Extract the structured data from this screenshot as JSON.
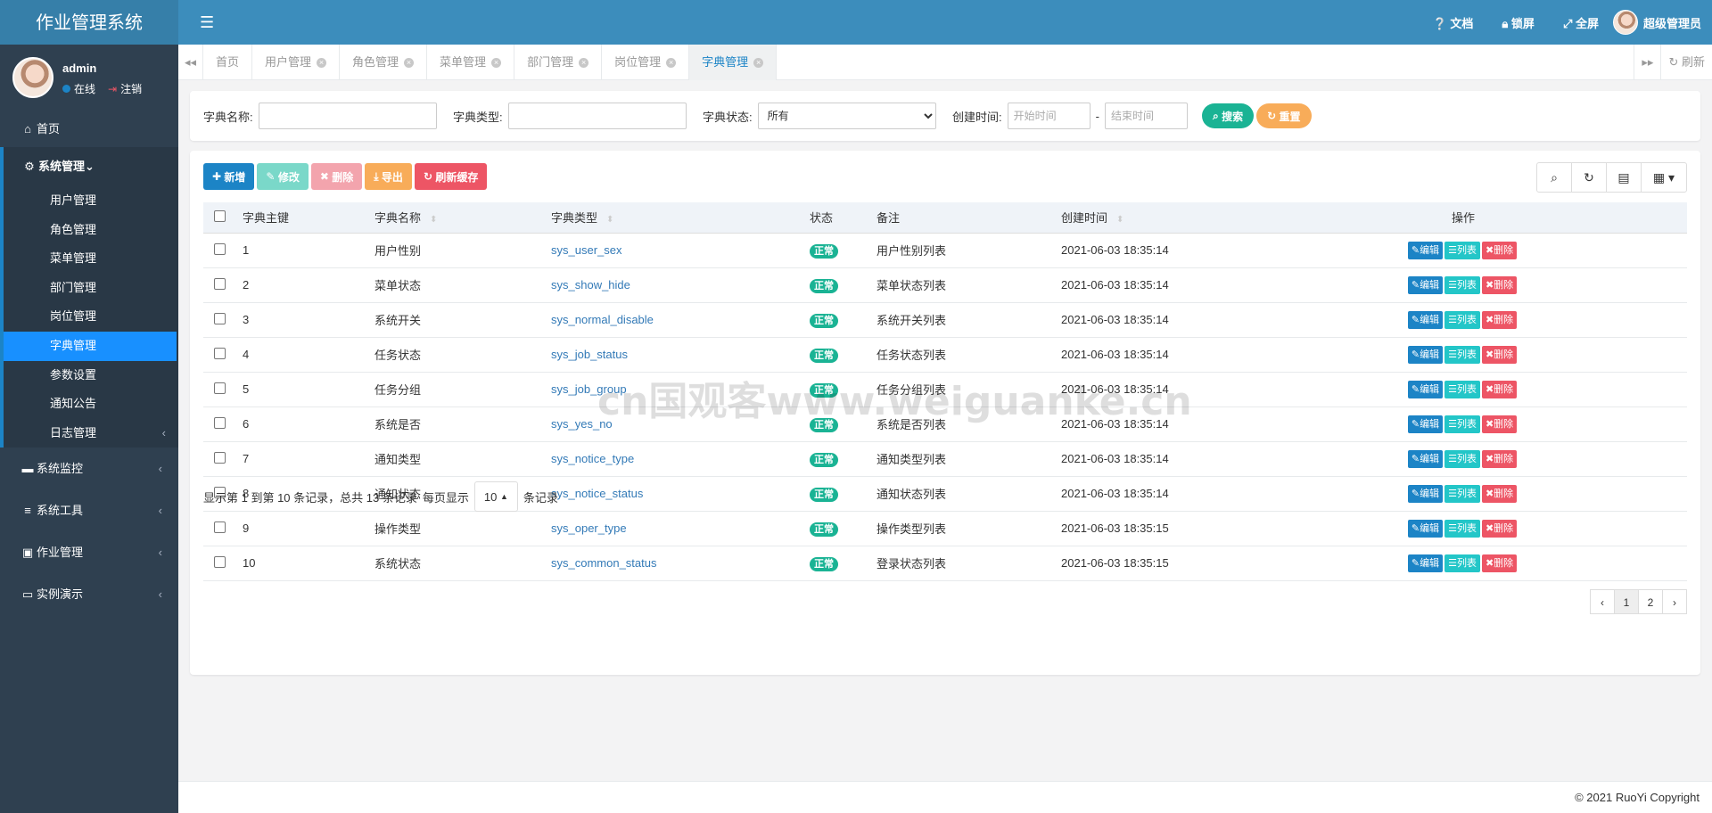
{
  "app": {
    "title": "作业管理系统"
  },
  "user": {
    "name": "admin",
    "status": "在线",
    "logout": "注销"
  },
  "topbar": {
    "doc": "文档",
    "lock": "锁屏",
    "fullscreen": "全屏",
    "username": "超级管理员"
  },
  "sidebar": {
    "home": "首页",
    "system": "系统管理",
    "system_items": [
      "用户管理",
      "角色管理",
      "菜单管理",
      "部门管理",
      "岗位管理",
      "字典管理",
      "参数设置",
      "通知公告",
      "日志管理"
    ],
    "monitor": "系统监控",
    "tools": "系统工具",
    "homework": "作业管理",
    "demo": "实例演示"
  },
  "tabs": {
    "home": "首页",
    "items": [
      "用户管理",
      "角色管理",
      "菜单管理",
      "部门管理",
      "岗位管理",
      "字典管理"
    ],
    "active": "字典管理",
    "refresh": "刷新"
  },
  "search": {
    "dict_name_label": "字典名称:",
    "dict_type_label": "字典类型:",
    "dict_status_label": "字典状态:",
    "dict_status_value": "所有",
    "create_time_label": "创建时间:",
    "start_placeholder": "开始时间",
    "end_placeholder": "结束时间",
    "separator": "-",
    "search_btn": "搜索",
    "reset_btn": "重置"
  },
  "toolbar": {
    "add": "新增",
    "edit": "修改",
    "delete": "删除",
    "export": "导出",
    "refresh_cache": "刷新缓存"
  },
  "colors": {
    "primary": "#1c84c6",
    "success": "#1ab394",
    "info": "#23c6c8",
    "danger": "#ed5565",
    "warning": "#f8ac59",
    "sidebar": "#2f4050",
    "topbar": "#3c8dbc"
  },
  "table": {
    "headers": [
      "字典主键",
      "字典名称",
      "字典类型",
      "状态",
      "备注",
      "创建时间",
      "操作"
    ],
    "rows": [
      {
        "id": "1",
        "name": "用户性别",
        "type": "sys_user_sex",
        "status": "正常",
        "remark": "用户性别列表",
        "time": "2021-06-03 18:35:14"
      },
      {
        "id": "2",
        "name": "菜单状态",
        "type": "sys_show_hide",
        "status": "正常",
        "remark": "菜单状态列表",
        "time": "2021-06-03 18:35:14"
      },
      {
        "id": "3",
        "name": "系统开关",
        "type": "sys_normal_disable",
        "status": "正常",
        "remark": "系统开关列表",
        "time": "2021-06-03 18:35:14"
      },
      {
        "id": "4",
        "name": "任务状态",
        "type": "sys_job_status",
        "status": "正常",
        "remark": "任务状态列表",
        "time": "2021-06-03 18:35:14"
      },
      {
        "id": "5",
        "name": "任务分组",
        "type": "sys_job_group",
        "status": "正常",
        "remark": "任务分组列表",
        "time": "2021-06-03 18:35:14"
      },
      {
        "id": "6",
        "name": "系统是否",
        "type": "sys_yes_no",
        "status": "正常",
        "remark": "系统是否列表",
        "time": "2021-06-03 18:35:14"
      },
      {
        "id": "7",
        "name": "通知类型",
        "type": "sys_notice_type",
        "status": "正常",
        "remark": "通知类型列表",
        "time": "2021-06-03 18:35:14"
      },
      {
        "id": "8",
        "name": "通知状态",
        "type": "sys_notice_status",
        "status": "正常",
        "remark": "通知状态列表",
        "time": "2021-06-03 18:35:14"
      },
      {
        "id": "9",
        "name": "操作类型",
        "type": "sys_oper_type",
        "status": "正常",
        "remark": "操作类型列表",
        "time": "2021-06-03 18:35:15"
      },
      {
        "id": "10",
        "name": "系统状态",
        "type": "sys_common_status",
        "status": "正常",
        "remark": "登录状态列表",
        "time": "2021-06-03 18:35:15"
      }
    ],
    "row_actions": {
      "edit": "编辑",
      "list": "列表",
      "delete": "删除"
    }
  },
  "pager": {
    "summary": "显示第 1 到第 10 条记录，总共 13 条记录",
    "per_page_prefix": "每页显示",
    "page_size": "10",
    "per_page_suffix": "条记录",
    "pages": [
      "1",
      "2"
    ],
    "prev": "‹",
    "next": "›"
  },
  "footer": {
    "copyright": "© 2021 RuoYi Copyright"
  },
  "watermark": "cn国观客www.weiguanke.cn"
}
